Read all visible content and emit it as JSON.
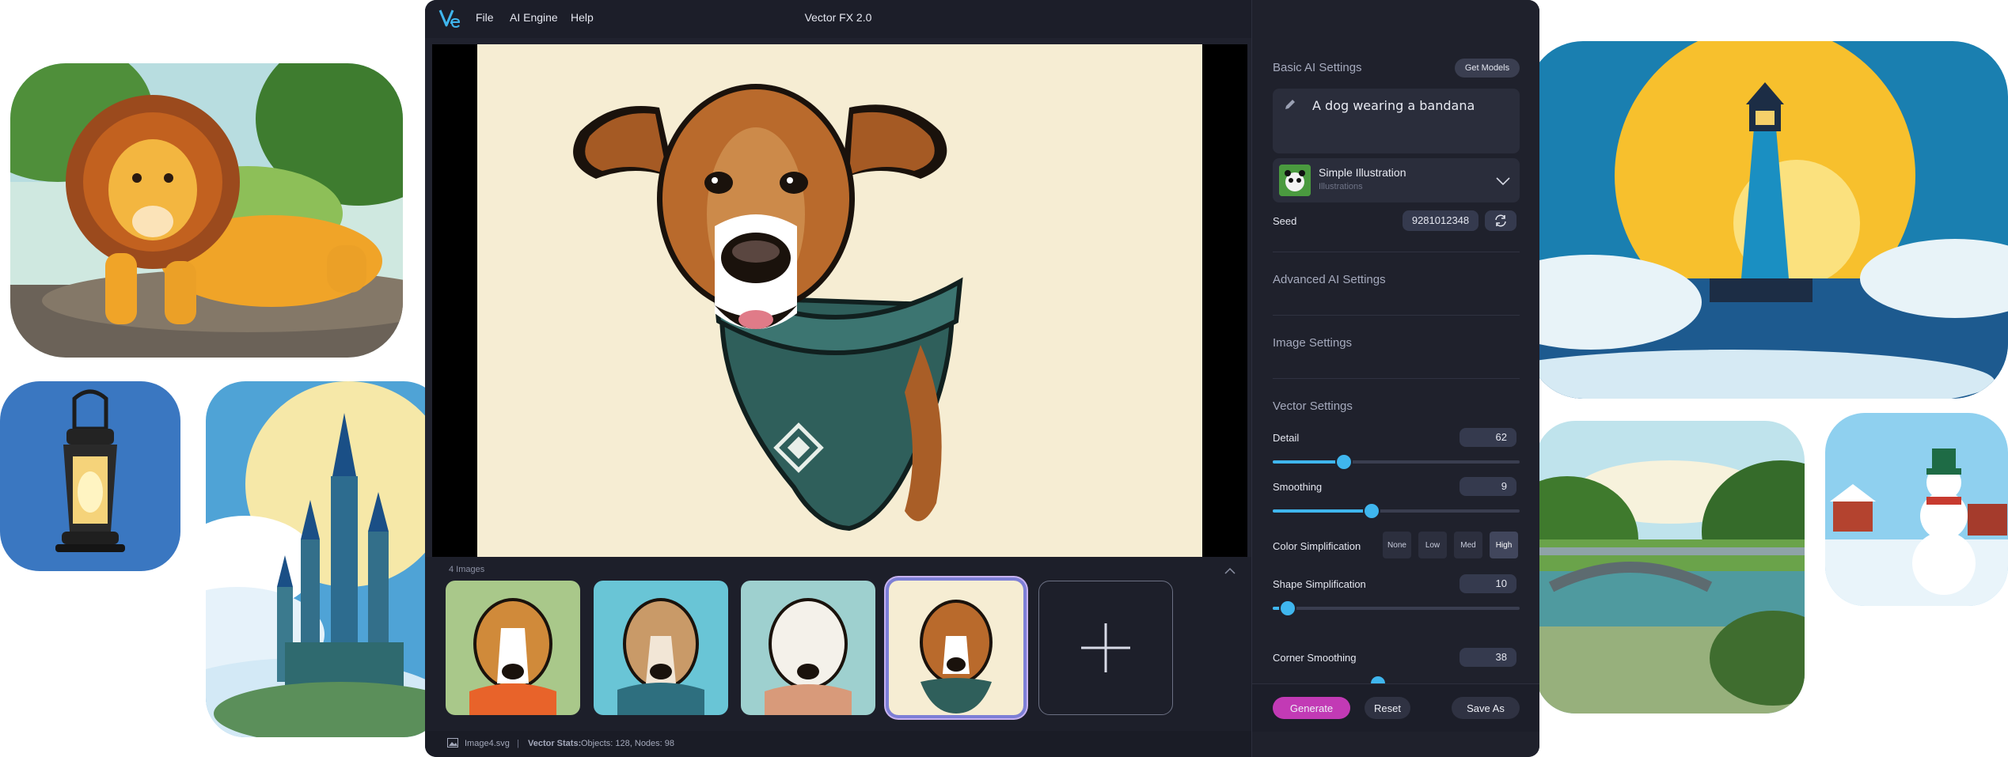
{
  "app": {
    "title": "Vector FX 2.0",
    "menu": [
      "File",
      "AI Engine",
      "Help"
    ]
  },
  "gallery": {
    "count_label": "4 Images"
  },
  "status": {
    "filename": "Image4.svg",
    "separator": "|",
    "stats_label": "Vector Stats:",
    "stats_value": "Objects: 128, Nodes: 98"
  },
  "panel": {
    "basic": {
      "title": "Basic AI Settings",
      "get_models_label": "Get Models",
      "prompt": "A dog wearing a bandana",
      "model_name": "Simple Illustration",
      "model_category": "Illustrations",
      "seed_label": "Seed",
      "seed_value": "9281012348"
    },
    "advanced_title": "Advanced AI Settings",
    "image_title": "Image Settings",
    "vector": {
      "title": "Vector Settings",
      "detail_label": "Detail",
      "detail_value": "62",
      "detail_level": 0.29,
      "smoothing_label": "Smoothing",
      "smoothing_value": "9",
      "smoothing_level": 0.4,
      "color_simplification_label": "Color Simplification",
      "color_simplification_options": [
        "None",
        "Low",
        "Med",
        "High"
      ],
      "color_simplification_selected": "High",
      "shape_simplification_label": "Shape Simplification",
      "shape_simplification_value": "10",
      "shape_simplification_level": 0.06,
      "corner_smoothing_label": "Corner Smoothing",
      "corner_smoothing_value": "38"
    },
    "actions": {
      "generate_label": "Generate",
      "reset_label": "Reset",
      "save_as_label": "Save As"
    }
  },
  "colors": {
    "accent": "#3fb6ee",
    "generate": "#c23ab5",
    "window_bg": "#20222e",
    "panel_bg": "#1f212c",
    "artboard": "#f6edd3"
  },
  "icons": [
    "app-logo-icon",
    "minimize-icon",
    "maximize-icon",
    "close-icon",
    "pencil-icon",
    "chevron-down-icon",
    "refresh-icon",
    "chevron-up-icon",
    "plus-icon",
    "image-icon"
  ]
}
